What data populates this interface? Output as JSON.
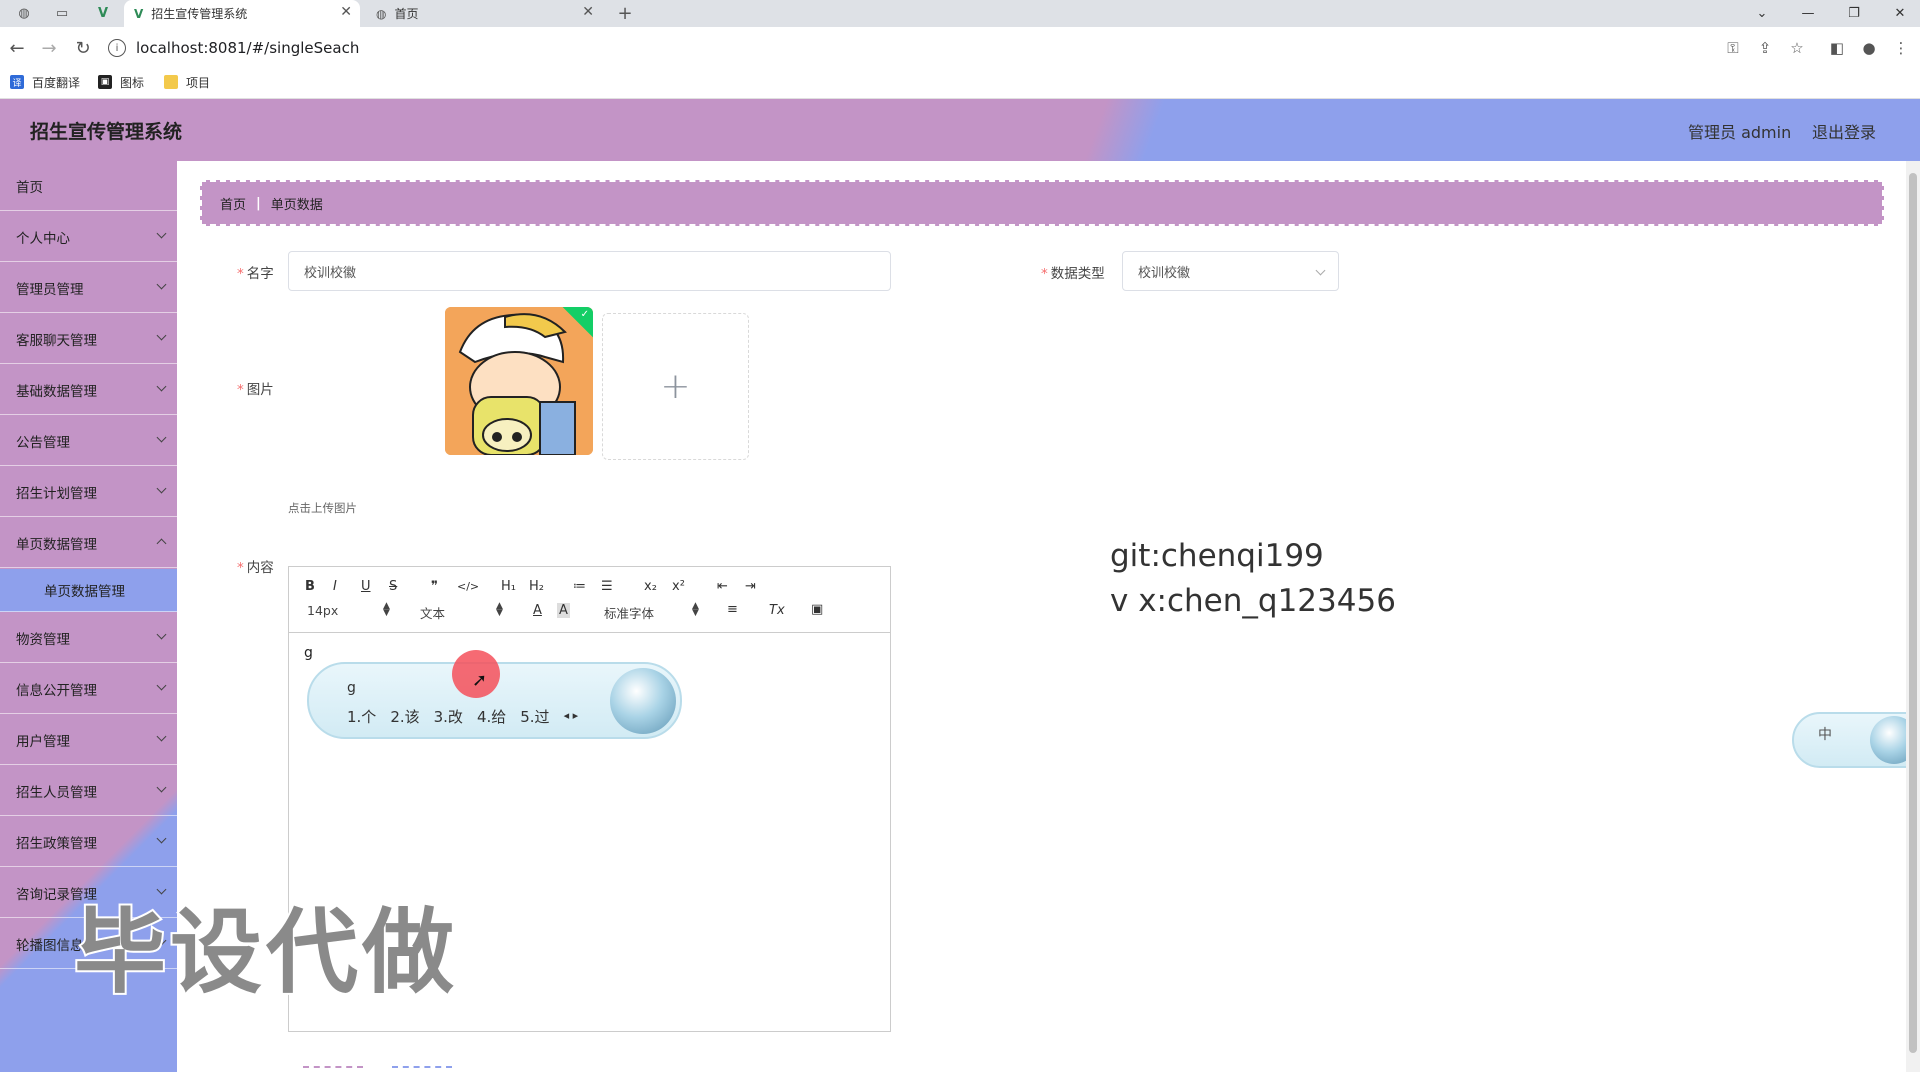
{
  "browser": {
    "tabs": [
      {
        "title": "招生宣传管理系统",
        "close": "✕"
      },
      {
        "title": "首页",
        "close": "✕"
      }
    ],
    "new_tab": "+",
    "url": "localhost:8081/#/singleSeach",
    "bookmarks": [
      "百度翻译",
      "图标",
      "项目"
    ],
    "window_controls": [
      "⌄",
      "—",
      "❐",
      "✕"
    ]
  },
  "header": {
    "title": "招生宣传管理系统",
    "user": "管理员 admin",
    "logout": "退出登录"
  },
  "sidebar": {
    "items": [
      {
        "label": "首页",
        "has_children": false
      },
      {
        "label": "个人中心",
        "has_children": true
      },
      {
        "label": "管理员管理",
        "has_children": true
      },
      {
        "label": "客服聊天管理",
        "has_children": true
      },
      {
        "label": "基础数据管理",
        "has_children": true
      },
      {
        "label": "公告管理",
        "has_children": true
      },
      {
        "label": "招生计划管理",
        "has_children": true
      },
      {
        "label": "单页数据管理",
        "has_children": true
      },
      {
        "label": "单页数据管理",
        "sub": true
      },
      {
        "label": "物资管理",
        "has_children": true
      },
      {
        "label": "信息公开管理",
        "has_children": true
      },
      {
        "label": "用户管理",
        "has_children": true
      },
      {
        "label": "招生人员管理",
        "has_children": true
      },
      {
        "label": "招生政策管理",
        "has_children": true
      },
      {
        "label": "咨询记录管理",
        "has_children": true
      },
      {
        "label": "轮播图信息",
        "has_children": true
      }
    ]
  },
  "breadcrumb": {
    "home": "首页",
    "current": "单页数据"
  },
  "form": {
    "name_label": "名字",
    "name_value": "校训校徽",
    "type_label": "数据类型",
    "type_value": "校训校徽",
    "image_label": "图片",
    "upload_plus": "+",
    "upload_hint": "点击上传图片",
    "content_label": "内容",
    "required_mark": "*"
  },
  "editor": {
    "toolbar_row1": [
      "B",
      "I",
      "U",
      "S",
      "❞",
      "</>",
      "H₁",
      "H₂",
      "≔",
      "☰",
      "x₂",
      "x²",
      "⇤",
      "⇥"
    ],
    "font_size": "14px",
    "block_type": "文本",
    "font_family": "标准字体",
    "content": "g"
  },
  "ime": {
    "composing": "g",
    "candidates": [
      "1.个",
      "2.该",
      "3.改",
      "4.给",
      "5.过"
    ],
    "mode": "中"
  },
  "overlay": {
    "line1": "git:chenqi199",
    "line2": "v x:chen_q123456",
    "watermark": "毕设代做"
  },
  "colors": {
    "primary_purple": "#c394c6",
    "secondary_blue": "#8ea0ec",
    "required_red": "#f56c6c"
  }
}
